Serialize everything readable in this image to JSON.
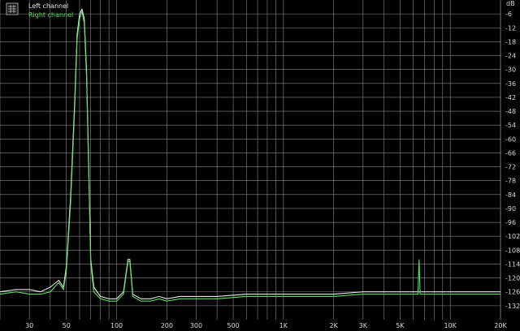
{
  "chart_data": {
    "type": "line",
    "x_scale": "log",
    "xlim": [
      20,
      20000
    ],
    "ylim": [
      -138,
      0
    ],
    "grid": true,
    "legend_position": "top-left",
    "y_unit_label": "dB",
    "x_ticks": [
      {
        "label": "30",
        "value": 30
      },
      {
        "label": "50",
        "value": 50
      },
      {
        "label": "100",
        "value": 100
      },
      {
        "label": "200",
        "value": 200
      },
      {
        "label": "300",
        "value": 300
      },
      {
        "label": "500",
        "value": 500
      },
      {
        "label": "1K",
        "value": 1000
      },
      {
        "label": "2K",
        "value": 2000
      },
      {
        "label": "3K",
        "value": 3000
      },
      {
        "label": "5K",
        "value": 5000
      },
      {
        "label": "10K",
        "value": 10000
      },
      {
        "label": "20K",
        "value": 20000
      }
    ],
    "y_ticks": [
      "-6",
      "-12",
      "-18",
      "-24",
      "-30",
      "-36",
      "-42",
      "-48",
      "-54",
      "-60",
      "-66",
      "-72",
      "-78",
      "-84",
      "-90",
      "-96",
      "-102",
      "-108",
      "-114",
      "-120",
      "-126",
      "-132"
    ],
    "series": [
      {
        "name": "Left channel",
        "color": "#e8e8e8",
        "points": [
          [
            20,
            -126
          ],
          [
            25,
            -125
          ],
          [
            30,
            -125
          ],
          [
            35,
            -126
          ],
          [
            40,
            -124
          ],
          [
            45,
            -121
          ],
          [
            48,
            -124
          ],
          [
            50,
            -115
          ],
          [
            53,
            -85
          ],
          [
            56,
            -45
          ],
          [
            58,
            -15
          ],
          [
            60,
            -6
          ],
          [
            62,
            -4
          ],
          [
            64,
            -8
          ],
          [
            66,
            -30
          ],
          [
            68,
            -70
          ],
          [
            70,
            -112
          ],
          [
            73,
            -124
          ],
          [
            80,
            -128
          ],
          [
            90,
            -129
          ],
          [
            100,
            -129
          ],
          [
            110,
            -126
          ],
          [
            117,
            -112
          ],
          [
            120,
            -112
          ],
          [
            125,
            -127
          ],
          [
            140,
            -129
          ],
          [
            160,
            -129
          ],
          [
            180,
            -128
          ],
          [
            200,
            -129
          ],
          [
            240,
            -128
          ],
          [
            300,
            -128
          ],
          [
            400,
            -128
          ],
          [
            600,
            -127
          ],
          [
            800,
            -127
          ],
          [
            1000,
            -127
          ],
          [
            1500,
            -127
          ],
          [
            2000,
            -127
          ],
          [
            3000,
            -126
          ],
          [
            4000,
            -126
          ],
          [
            5000,
            -126
          ],
          [
            6000,
            -126
          ],
          [
            6400,
            -126
          ],
          [
            6600,
            -126
          ],
          [
            8000,
            -126
          ],
          [
            10000,
            -126
          ],
          [
            15000,
            -126
          ],
          [
            20000,
            -126
          ]
        ]
      },
      {
        "name": "Right channel",
        "color": "#57e35a",
        "points": [
          [
            20,
            -127
          ],
          [
            25,
            -126
          ],
          [
            30,
            -127
          ],
          [
            35,
            -127
          ],
          [
            40,
            -126
          ],
          [
            45,
            -122
          ],
          [
            48,
            -125
          ],
          [
            50,
            -117
          ],
          [
            53,
            -88
          ],
          [
            56,
            -48
          ],
          [
            58,
            -17
          ],
          [
            60,
            -8
          ],
          [
            62,
            -5
          ],
          [
            64,
            -10
          ],
          [
            66,
            -33
          ],
          [
            68,
            -73
          ],
          [
            70,
            -114
          ],
          [
            73,
            -126
          ],
          [
            80,
            -129
          ],
          [
            90,
            -130
          ],
          [
            100,
            -130
          ],
          [
            110,
            -127
          ],
          [
            117,
            -113
          ],
          [
            120,
            -113
          ],
          [
            125,
            -128
          ],
          [
            140,
            -130
          ],
          [
            160,
            -130
          ],
          [
            180,
            -129
          ],
          [
            200,
            -130
          ],
          [
            240,
            -129
          ],
          [
            300,
            -129
          ],
          [
            400,
            -129
          ],
          [
            600,
            -128
          ],
          [
            800,
            -128
          ],
          [
            1000,
            -128
          ],
          [
            1500,
            -128
          ],
          [
            2000,
            -128
          ],
          [
            3000,
            -127
          ],
          [
            4000,
            -127
          ],
          [
            5000,
            -127
          ],
          [
            6000,
            -127
          ],
          [
            6400,
            -127
          ],
          [
            6500,
            -112
          ],
          [
            6600,
            -127
          ],
          [
            8000,
            -127
          ],
          [
            10000,
            -127
          ],
          [
            15000,
            -127
          ],
          [
            20000,
            -127
          ]
        ]
      }
    ]
  },
  "colors": {
    "background": "#000000",
    "grid": "#8a8a8a",
    "left_channel": "#e8e8e8",
    "right_channel": "#57e35a",
    "tick_text": "#d8d8d8"
  },
  "icons": {
    "legend_toggle": "grid-icon"
  }
}
